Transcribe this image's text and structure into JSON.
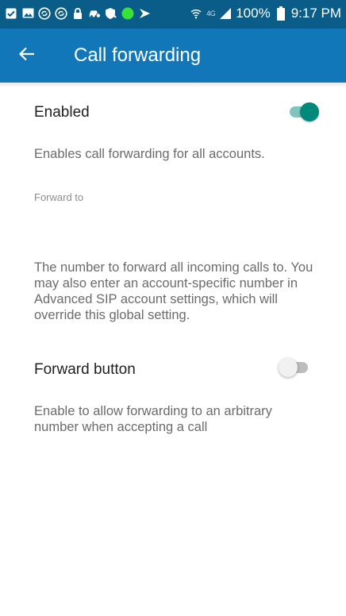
{
  "status_bar": {
    "network": "4G",
    "battery": "100%",
    "time": "9:17 PM",
    "icons_left": [
      "checkbox-icon",
      "image-icon",
      "sync-icon",
      "sync-icon",
      "lock-icon",
      "car-icon",
      "shield-icon",
      "green-dot-icon",
      "flag-icon"
    ],
    "icons_right": [
      "wifi-icon",
      "signal-icon",
      "battery-icon"
    ]
  },
  "app_bar": {
    "title": "Call forwarding",
    "back_icon": "arrow-back-icon",
    "background": "#1177b8"
  },
  "settings": {
    "enabled": {
      "label": "Enabled",
      "summary": "Enables call forwarding for all accounts.",
      "checked": true
    },
    "forward_to": {
      "label": "Forward to",
      "value": "",
      "summary": "The number to forward all incoming calls to. You may also enter an account-specific number in Advanced SIP account settings, which will override this global setting."
    },
    "forward_button": {
      "label": "Forward button",
      "summary": "Enable to allow forwarding to an arbitrary number when accepting a call",
      "checked": false
    }
  },
  "colors": {
    "status_bar": "#0a5d89",
    "switch_on": "#00897b",
    "switch_off": "#bdbdbd"
  }
}
